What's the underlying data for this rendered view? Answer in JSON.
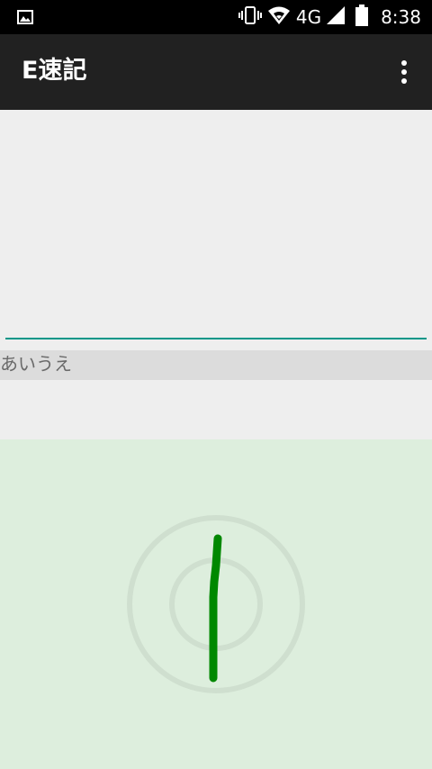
{
  "status_bar": {
    "left_icon": "image-icon",
    "network": "4G",
    "time": "8:38",
    "icons": [
      "vibrate-icon",
      "wifi-icon",
      "signal-icon",
      "battery-icon"
    ]
  },
  "app_bar": {
    "title": "E速記",
    "menu_icon": "more-vert-icon"
  },
  "editor": {
    "value": "",
    "accent_color": "#009688"
  },
  "candidate": {
    "text": "あいうえ"
  },
  "pad": {
    "background": "#ddeedd",
    "ring_color": "#cfdfcf",
    "stroke_color": "#008800"
  }
}
